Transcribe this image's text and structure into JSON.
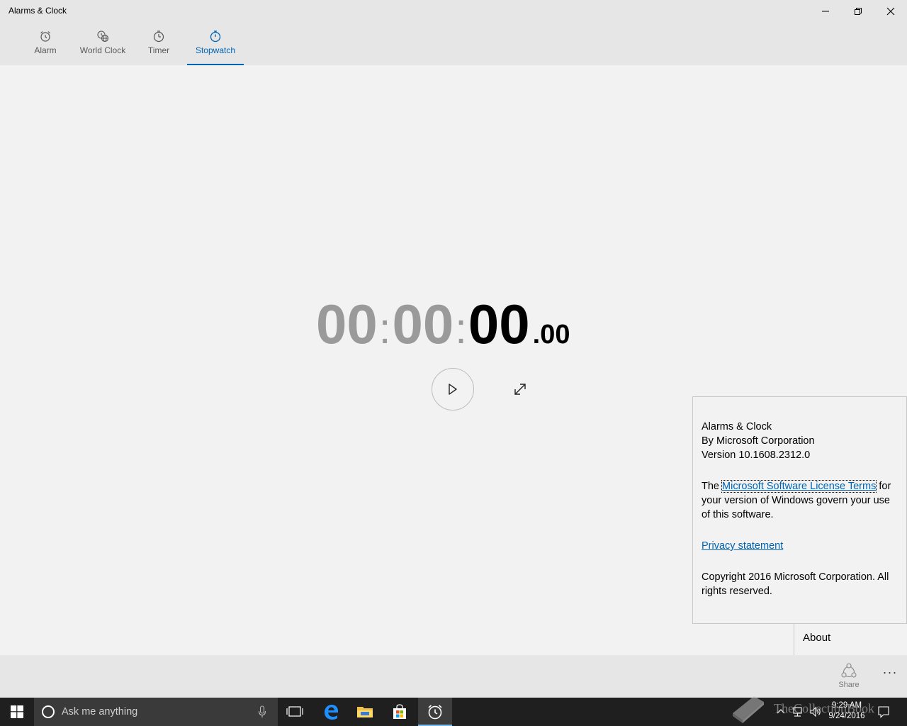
{
  "window": {
    "title": "Alarms & Clock"
  },
  "tabs": [
    {
      "label": "Alarm",
      "icon": "alarm-icon",
      "active": false
    },
    {
      "label": "World Clock",
      "icon": "globe-clock-icon",
      "active": false
    },
    {
      "label": "Timer",
      "icon": "timer-icon",
      "active": false
    },
    {
      "label": "Stopwatch",
      "icon": "stopwatch-icon",
      "active": true
    }
  ],
  "stopwatch": {
    "hours": "00",
    "minutes": "00",
    "seconds": "00",
    "fraction": ".00",
    "colon": ":"
  },
  "about": {
    "app_name": "Alarms & Clock",
    "publisher": "By Microsoft Corporation",
    "version": "Version 10.1608.2312.0",
    "license_prefix": "The",
    "license_link": "Microsoft Software License Terms",
    "license_suffix": "for your version of Windows govern your use of this software.",
    "privacy_link": "Privacy statement",
    "copyright": "Copyright 2016 Microsoft Corporation. All rights reserved.",
    "menu_item": "About"
  },
  "commandbar": {
    "share_label": "Share",
    "more_label": "···"
  },
  "taskbar": {
    "search_placeholder": "Ask me anything",
    "time": "9:29 AM",
    "date": "9/24/2016",
    "watermark": "TheCollectionBook"
  },
  "colors": {
    "accent": "#0063b1",
    "background": "#f2f2f2",
    "chrome": "#e6e6e6",
    "taskbar": "#1f1f1f"
  }
}
